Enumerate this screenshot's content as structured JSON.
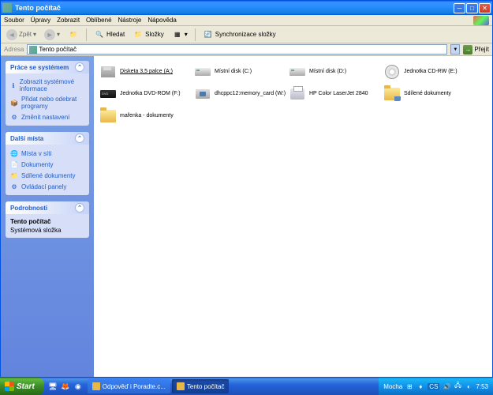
{
  "window": {
    "title": "Tento počítač"
  },
  "menu": {
    "file": "Soubor",
    "edit": "Úpravy",
    "view": "Zobrazit",
    "favorites": "Oblíbené",
    "tools": "Nástroje",
    "help": "Nápověda"
  },
  "toolbar": {
    "back": "Zpět",
    "search": "Hledat",
    "folders": "Složky",
    "sync": "Synchronizace složky"
  },
  "address": {
    "label": "Adresa",
    "value": "Tento počítač",
    "go": "Přejít"
  },
  "panels": {
    "tasks": {
      "title": "Práce se systémem",
      "items": [
        "Zobrazit systémové informace",
        "Přidat nebo odebrat programy",
        "Změnit nastavení"
      ]
    },
    "places": {
      "title": "Další místa",
      "items": [
        "Místa v síti",
        "Dokumenty",
        "Sdílené dokumenty",
        "Ovládací panely"
      ]
    },
    "details": {
      "title": "Podrobnosti",
      "name": "Tento počítač",
      "type": "Systémová složka"
    }
  },
  "items": [
    {
      "label": "Disketa 3,5 palce (A:)",
      "icon": "floppy",
      "selected": true
    },
    {
      "label": "Místní disk (C:)",
      "icon": "drive"
    },
    {
      "label": "Místní disk (D:)",
      "icon": "drive"
    },
    {
      "label": "Jednotka CD-RW (E:)",
      "icon": "cdrom"
    },
    {
      "label": "Jednotka DVD-ROM (F:)",
      "icon": "dvd"
    },
    {
      "label": "dhcppc12:memory_card (W:)",
      "icon": "card"
    },
    {
      "label": "HP Color LaserJet 2840",
      "icon": "printer"
    },
    {
      "label": "Sdílené dokumenty",
      "icon": "folder shared"
    },
    {
      "label": "mařenka - dokumenty",
      "icon": "folder"
    }
  ],
  "taskbar": {
    "start": "Start",
    "tasks": [
      {
        "label": "Odpověď i Poradte.c..."
      },
      {
        "label": "Tento počítač",
        "active": true
      }
    ],
    "tray": {
      "mocha": "Mocha",
      "lang": "CS",
      "time": "7:53"
    }
  }
}
